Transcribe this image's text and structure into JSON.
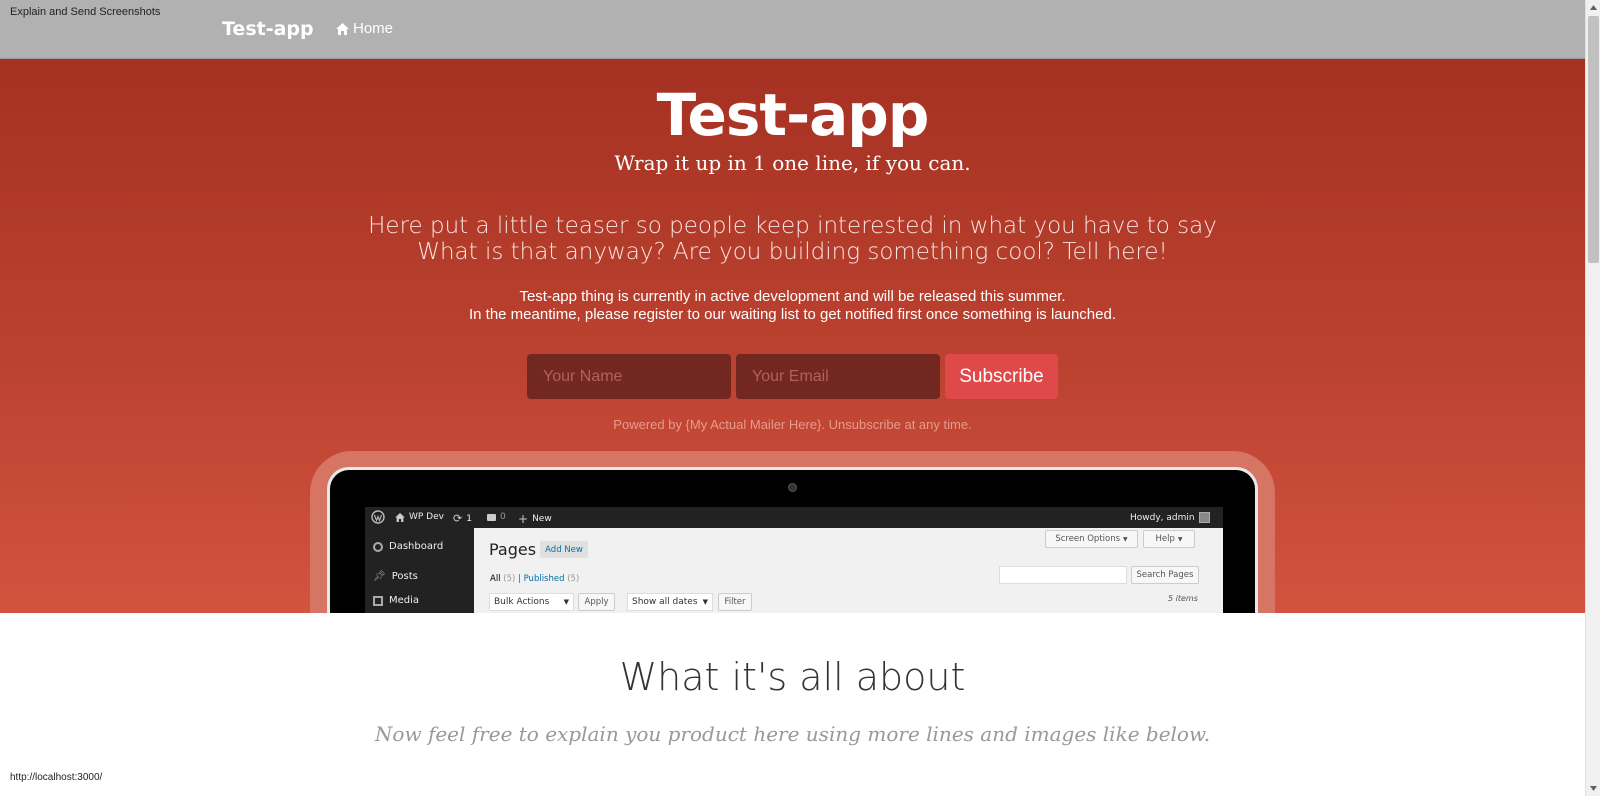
{
  "window": {
    "title": "Explain and Send Screenshots",
    "status_url": "http://localhost:3000/"
  },
  "navbar": {
    "brand": "Test-app",
    "home_label": "Home"
  },
  "hero": {
    "title": "Test-app",
    "tagline": "Wrap it up in 1 one line, if you can.",
    "teaser_line1": "Here put a little teaser so people keep interested in what you have to say",
    "teaser_line2": "What is that anyway? Are you building something cool? Tell here!",
    "info_line1": "Test-app thing is currently in active development and will be released this summer.",
    "info_line2": "In the meantime, please register to our waiting list to get notified first once something is launched.",
    "name_placeholder": "Your Name",
    "email_placeholder": "Your Email",
    "subscribe_label": "Subscribe",
    "powered_by": "Powered by {My Actual Mailer Here}. Unsubscribe at any time."
  },
  "wp_preview": {
    "adminbar": {
      "site_name": "WP Dev",
      "updates_count": "1",
      "comments_count": "0",
      "new_label": "New",
      "howdy": "Howdy, admin"
    },
    "sidebar": {
      "items": [
        {
          "label": "Dashboard"
        },
        {
          "label": "Posts"
        },
        {
          "label": "Media"
        }
      ]
    },
    "content": {
      "title": "Pages",
      "add_new": "Add New",
      "screen_options": "Screen Options",
      "help": "Help",
      "filter_all": "All",
      "filter_all_count": "(5)",
      "filter_published": "Published",
      "filter_published_count": "(5)",
      "search_button": "Search Pages",
      "bulk_actions": "Bulk Actions",
      "apply": "Apply",
      "show_all_dates": "Show all dates",
      "filter_button": "Filter",
      "items_count": "5 items"
    }
  },
  "about": {
    "title": "What it's all about",
    "subtitle": "Now feel free to explain you product here using more lines and images like below."
  },
  "colors": {
    "navbar": "#b1b1b1",
    "hero_top": "#a53122",
    "hero_bottom": "#d3533f",
    "subscribe": "#e0494a",
    "input_bg": "#722821"
  }
}
